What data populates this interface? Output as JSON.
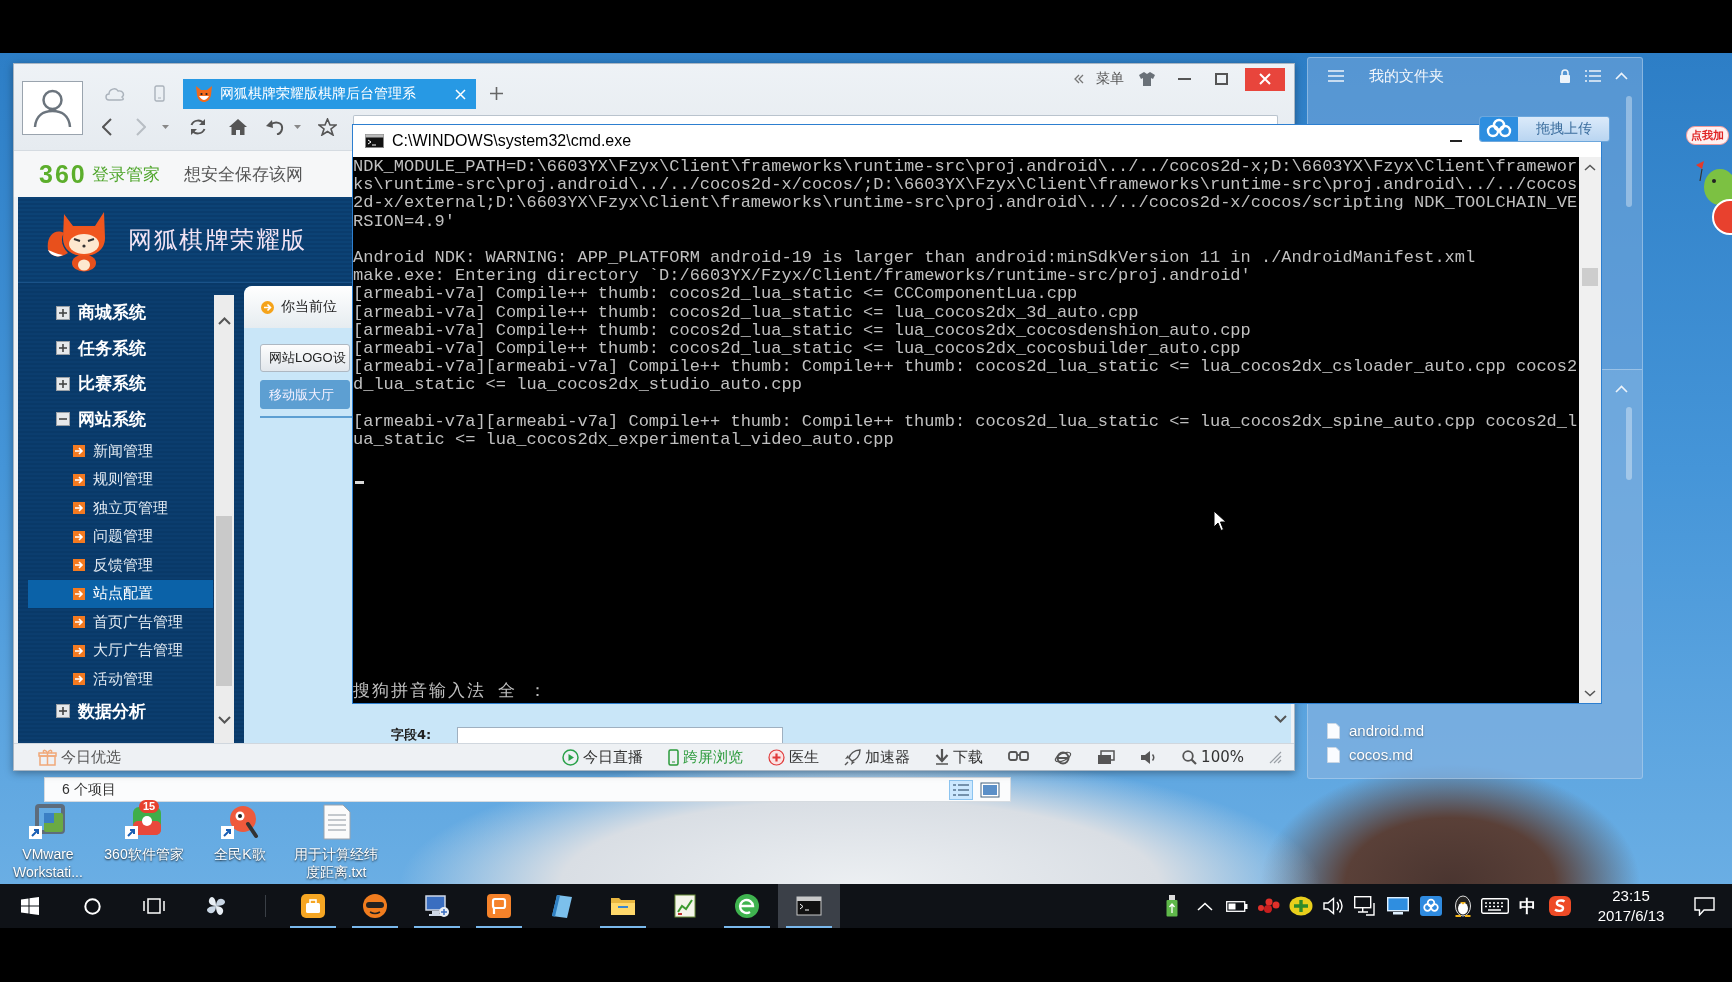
{
  "browser": {
    "tabs": [
      {
        "title": "网狐棋牌荣耀版棋牌后台管理系",
        "selected": true
      }
    ],
    "menu_label": "菜单",
    "login_bar": {
      "logo_number": "360",
      "logo_text": "登录管家",
      "prompt": "想安全保存该网"
    },
    "page": {
      "site_title": "网狐棋牌荣耀版",
      "menu": [
        {
          "label": "商城系统",
          "expanded": false
        },
        {
          "label": "任务系统",
          "expanded": false
        },
        {
          "label": "比赛系统",
          "expanded": false
        },
        {
          "label": "网站系统",
          "expanded": true,
          "children": [
            {
              "label": "新闻管理",
              "selected": false
            },
            {
              "label": "规则管理",
              "selected": false
            },
            {
              "label": "独立页管理",
              "selected": false
            },
            {
              "label": "问题管理",
              "selected": false
            },
            {
              "label": "反馈管理",
              "selected": false
            },
            {
              "label": "站点配置",
              "selected": true
            },
            {
              "label": "首页广告管理",
              "selected": false
            },
            {
              "label": "大厅广告管理",
              "selected": false
            },
            {
              "label": "活动管理",
              "selected": false
            }
          ]
        },
        {
          "label": "数据分析",
          "expanded": false
        }
      ],
      "breadcrumb": "你当前位",
      "content_tabs": [
        {
          "label": "网站LOGO设",
          "selected": false
        },
        {
          "label": "移动版大厅",
          "selected": true
        }
      ],
      "fields": [
        {
          "label": "字段4:"
        }
      ]
    },
    "status_bar": {
      "promo": "今日优选",
      "items": [
        {
          "kind": "live",
          "label": "今日直播",
          "highlighted": false
        },
        {
          "kind": "cross_screen",
          "label": "跨屏浏览",
          "highlighted": true
        },
        {
          "kind": "doctor",
          "label": "医生",
          "highlighted": false
        },
        {
          "kind": "accelerator",
          "label": "加速器",
          "highlighted": false
        },
        {
          "kind": "download",
          "label": "下载",
          "highlighted": false
        }
      ],
      "zoom": "100%"
    }
  },
  "cloud_panel": {
    "title": "我的文件夹",
    "upload_button": "拖拽上传",
    "files": [
      {
        "name": "android.md"
      },
      {
        "name": "cocos.md"
      }
    ]
  },
  "promo_sticker": "点我加",
  "cmd": {
    "title": "C:\\WINDOWS\\system32\\cmd.exe",
    "blocks": [
      [
        "NDK_MODULE_PATH=D:\\6603YX\\Fzyx\\Client\\frameworks\\runtime-src\\proj.android\\../../cocos2d-x;D:\\6603YX\\Fzyx\\Client\\framewor",
        "ks\\runtime-src\\proj.android\\../../cocos2d-x/cocos/;D:\\6603YX\\Fzyx\\Client\\frameworks\\runtime-src\\proj.android\\../../cocos",
        "2d-x/external;D:\\6603YX\\Fzyx\\Client\\frameworks\\runtime-src\\proj.android\\../../cocos2d-x/cocos/scripting NDK_TOOLCHAIN_VE",
        "RSION=4.9'"
      ],
      [
        "Android NDK: WARNING: APP_PLATFORM android-19 is larger than android:minSdkVersion 11 in ./AndroidManifest.xml",
        "make.exe: Entering directory `D:/6603YX/Fzyx/Client/frameworks/runtime-src/proj.android'",
        "[armeabi-v7a] Compile++ thumb: cocos2d_lua_static <= CCComponentLua.cpp",
        "[armeabi-v7a] Compile++ thumb: cocos2d_lua_static <= lua_cocos2dx_3d_auto.cpp",
        "[armeabi-v7a] Compile++ thumb: cocos2d_lua_static <= lua_cocos2dx_cocosdenshion_auto.cpp",
        "[armeabi-v7a] Compile++ thumb: cocos2d_lua_static <= lua_cocos2dx_cocosbuilder_auto.cpp",
        "[armeabi-v7a][armeabi-v7a] Compile++ thumb: Compile++ thumb: cocos2d_lua_static <= lua_cocos2dx_csloader_auto.cpp cocos2",
        "d_lua_static <= lua_cocos2dx_studio_auto.cpp"
      ],
      [
        "[armeabi-v7a][armeabi-v7a] Compile++ thumb: Compile++ thumb: cocos2d_lua_static <= lua_cocos2dx_spine_auto.cpp cocos2d_l",
        "ua_static <= lua_cocos2dx_experimental_video_auto.cpp"
      ]
    ],
    "ime_status": "搜狗拼音输入法 全 ："
  },
  "explorer_status": {
    "item_count": "6 个项目",
    "views": [
      {
        "kind": "details",
        "selected": true
      },
      {
        "kind": "large_icons",
        "selected": false
      }
    ]
  },
  "desktop_icons": [
    {
      "kind": "vmware",
      "label": "VMware Workstati...",
      "shortcut": true
    },
    {
      "kind": "store",
      "label": "360软件管家",
      "badge": "15",
      "shortcut": true
    },
    {
      "kind": "karaoke",
      "label": "全民K歌",
      "shortcut": true
    },
    {
      "kind": "text_file",
      "label": "用于计算经纬度距离.txt",
      "shortcut": false
    }
  ],
  "taskbar": {
    "apps": [
      {
        "kind": "briefcase",
        "running": true,
        "selected": false
      },
      {
        "kind": "mascot",
        "running": true,
        "selected": false
      },
      {
        "kind": "computer",
        "running": true,
        "selected": false
      },
      {
        "kind": "slides",
        "running": true,
        "selected": false
      },
      {
        "kind": "notebook",
        "running": false,
        "selected": false
      },
      {
        "kind": "folder",
        "running": true,
        "selected": false
      },
      {
        "kind": "chart",
        "running": false,
        "selected": false
      },
      {
        "kind": "browser",
        "running": true,
        "selected": false
      },
      {
        "kind": "terminal",
        "running": true,
        "selected": true
      }
    ],
    "ime": "中",
    "time": "23:15",
    "date": "2017/6/13"
  }
}
